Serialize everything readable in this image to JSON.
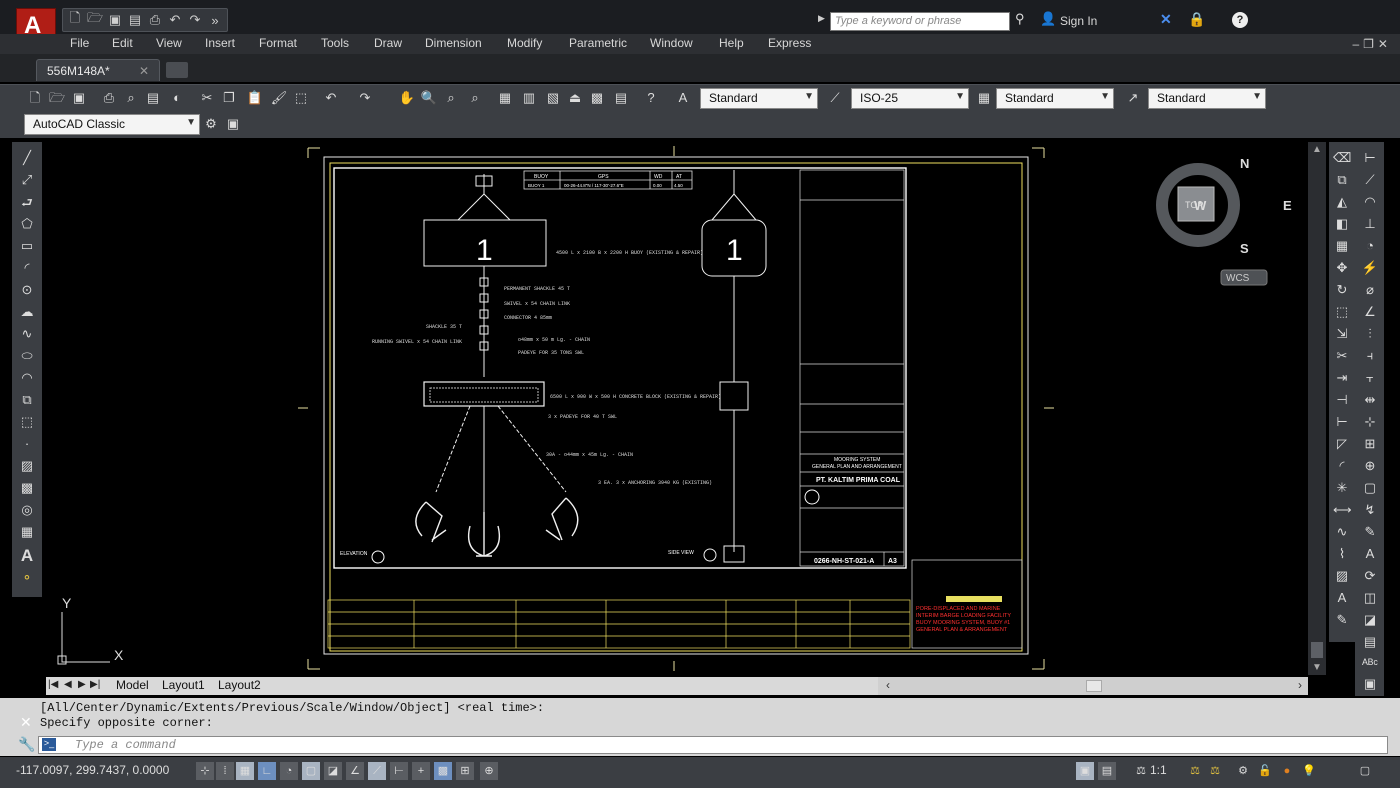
{
  "app": {
    "search_placeholder": "Type a keyword or phrase",
    "sign_in": "Sign In"
  },
  "menu": [
    "File",
    "Edit",
    "View",
    "Insert",
    "Format",
    "Tools",
    "Draw",
    "Dimension",
    "Modify",
    "Parametric",
    "Window",
    "Help",
    "Express"
  ],
  "file_tab": {
    "name": "556M148A*"
  },
  "toolbar": {
    "text_style": "Standard",
    "dim_style": "ISO-25",
    "table_style": "Standard",
    "multileader_style": "Standard",
    "workspace": "AutoCAD Classic"
  },
  "viewcube": {
    "north": "N",
    "south": "S",
    "east": "E",
    "west": "W",
    "face": "TOP",
    "ucs": "WCS"
  },
  "ucs_icon": {
    "x": "X",
    "y": "Y"
  },
  "drawing": {
    "buoy_number": "1",
    "table_header": [
      "BUOY",
      "GPS",
      "WD",
      "AT"
    ],
    "table_row": [
      "BUOY 1",
      "00-26-44.8\"N / 117-30'-27.6\"E",
      "0.00",
      "4.50"
    ],
    "labels_left": [
      "4500 L x 2100 B x 2200 H BUOY (EXISTING & REPAIR)",
      "PERMANENT SHACKLE 45 T",
      "SWIVEL x 54 CHAIN LINK",
      "CONNECTOR 4 85mm",
      "SHACKLE 35 T",
      "RUNNING SWIVEL x 54 CHAIN LINK",
      "o48mm x 50 m Lg. - CHAIN",
      "PADEYE FOR 35 TONS SWL",
      "6500 L x 900 W x 500 H CONCRETE BLOCK (EXISTING & REPAIR)",
      "3 x PADEYE FOR 40 T SWL",
      "30A - o44mm x 45m Lg. - CHAIN",
      "3 EA. 3 x ANCHORING 3940 KG (EXISTING)"
    ],
    "elevation_label": "ELEVATION",
    "side_view_label": "SIDE VIEW",
    "company": "PT. KALTIM PRIMA COAL",
    "title_lines": [
      "MOORING SYSTEM",
      "GENERAL PLAN AND ARRANGEMENT"
    ],
    "drawing_no": "0266-NH-ST-021-A",
    "sheet_size": "A3",
    "red_stamp": [
      "PORE-DISPLACED AND MARINE",
      "INTERIM BARGE LOADING FACILITY",
      "BUOY MOORING SYSTEM, BUOY #1",
      "GENERAL PLAN & ARRANGEMENT"
    ]
  },
  "layout_tabs": [
    "Model",
    "Layout1",
    "Layout2"
  ],
  "command": {
    "history": [
      "[All/Center/Dynamic/Extents/Previous/Scale/Window/Object] <real time>:",
      "Specify opposite corner:"
    ],
    "placeholder": "Type a command"
  },
  "status": {
    "coordinates": "-117.0097, 299.7437, 0.0000",
    "annotation_scale": "1:1"
  }
}
